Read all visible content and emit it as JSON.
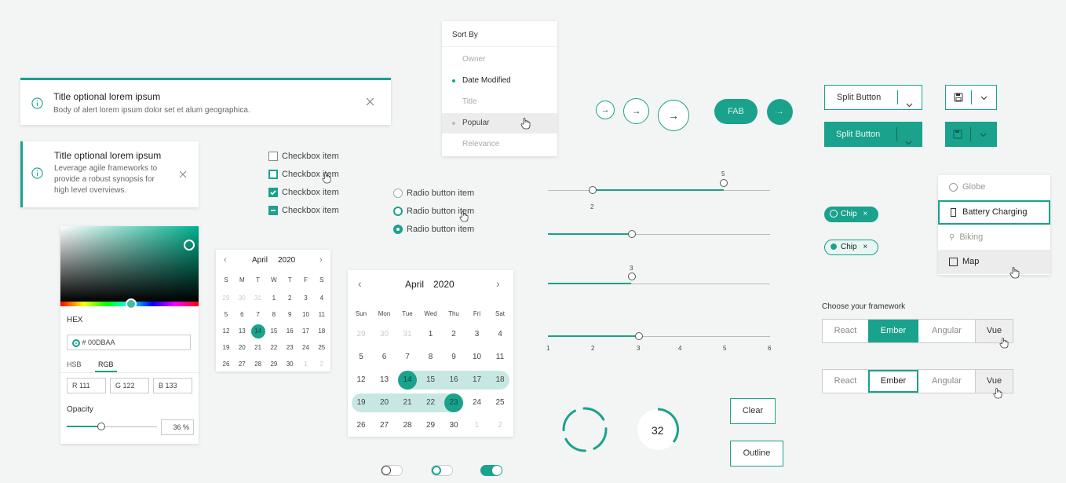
{
  "alerts": {
    "primary": {
      "title": "Title optional lorem ipsum",
      "body": "Body of alert lorem ipsum dolor set et alum geographica."
    },
    "side": {
      "title": "Title optional lorem ipsum",
      "body_lines": [
        "Leverage agile frameworks to",
        "provide a robust synopsis for",
        "high level overviews."
      ]
    }
  },
  "sort_menu": {
    "header": "Sort By",
    "items": [
      "Owner",
      "Date Modified",
      "Title",
      "Popular",
      "Relevance"
    ],
    "selected": "Date Modified",
    "hovered": "Popular"
  },
  "checkboxes": [
    "Checkbox item",
    "Checkbox item",
    "Checkbox item",
    "Checkbox item"
  ],
  "radios": [
    "Radio button item",
    "Radio button item",
    "Radio button item"
  ],
  "color_picker": {
    "hex_label": "HEX",
    "hex_value": "# 00DBAA",
    "tabs": [
      "HSB",
      "RGB"
    ],
    "active_tab": "RGB",
    "r": "R 111",
    "g": "G 122",
    "b": "B 133",
    "opacity_label": "Opacity",
    "opacity_value": "36 %"
  },
  "calendar_small": {
    "month": "April",
    "year": "2020",
    "weekdays": [
      "S",
      "M",
      "T",
      "W",
      "T",
      "F",
      "S"
    ],
    "rows": [
      [
        "29",
        "30",
        "31",
        "1",
        "2",
        "3",
        "4"
      ],
      [
        "5",
        "6",
        "7",
        "8",
        "9",
        "10",
        "11"
      ],
      [
        "12",
        "13",
        "14",
        "15",
        "16",
        "17",
        "18"
      ],
      [
        "19",
        "20",
        "21",
        "22",
        "23",
        "24",
        "25"
      ],
      [
        "26",
        "27",
        "28",
        "29",
        "30",
        "1",
        "2"
      ]
    ],
    "selected": "14"
  },
  "calendar_big": {
    "month": "April",
    "year": "2020",
    "weekdays": [
      "Sun",
      "Mon",
      "Tue",
      "Wed",
      "Thu",
      "Fri",
      "Sat"
    ],
    "rows": [
      [
        "29",
        "30",
        "31",
        "1",
        "2",
        "3",
        "4"
      ],
      [
        "5",
        "6",
        "7",
        "8",
        "9",
        "10",
        "11"
      ],
      [
        "12",
        "13",
        "14",
        "15",
        "16",
        "17",
        "18"
      ],
      [
        "19",
        "20",
        "21",
        "22",
        "23",
        "24",
        "25"
      ],
      [
        "26",
        "27",
        "28",
        "29",
        "30",
        "1",
        "2"
      ]
    ],
    "range_start": "14",
    "range_end": "23"
  },
  "sliders": {
    "range_low_label": "2",
    "range_high_label": "5",
    "single_label": "3",
    "ticks": [
      "1",
      "2",
      "3",
      "4",
      "5",
      "6"
    ]
  },
  "icon_buttons": {
    "arrow": "→"
  },
  "fab": {
    "label": "FAB"
  },
  "split_buttons": {
    "label": "Split Button"
  },
  "chips": [
    "Chip",
    "Chip"
  ],
  "dropdown": {
    "items": [
      "Globe",
      "Battery Charging",
      "Biking",
      "Map"
    ],
    "selected": "Battery Charging",
    "hovered": "Map"
  },
  "framework": {
    "label": "Choose your framework",
    "options": [
      "React",
      "Ember",
      "Angular",
      "Vue"
    ],
    "selected": "Ember"
  },
  "progress": {
    "value": "32"
  },
  "text_buttons": {
    "clear": "Clear",
    "outline": "Outline"
  }
}
